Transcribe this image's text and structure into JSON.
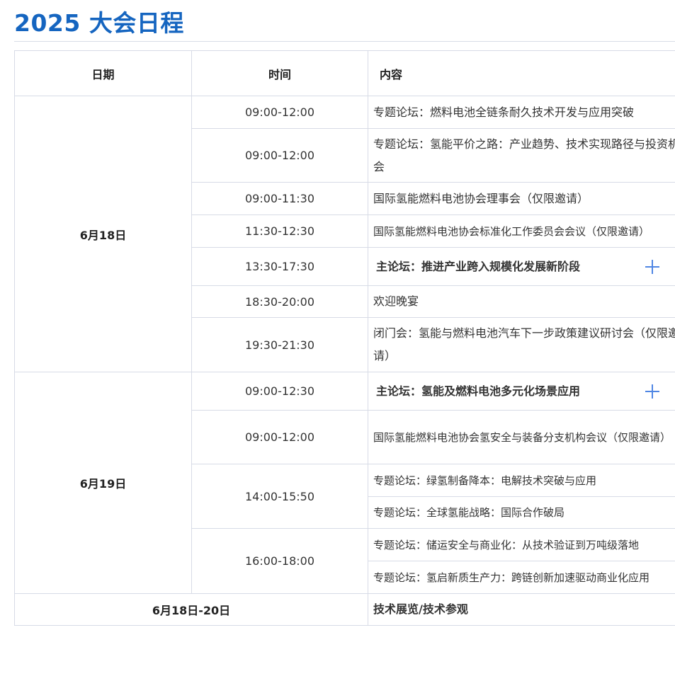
{
  "page": {
    "title": "2025 大会日程"
  },
  "table": {
    "headers": {
      "date": "日期",
      "time": "时间",
      "content": "内容"
    },
    "day1": {
      "date": "6月18日",
      "rows": [
        {
          "time": "09:00-12:00",
          "content": "专题论坛：燃料电池全链条耐久技术开发与应用突破"
        },
        {
          "time": "09:00-12:00",
          "content": "专题论坛：氢能平价之路：产业趋势、技术实现路径与投资机会"
        },
        {
          "time": "09:00-11:30",
          "content": "国际氢能燃料电池协会理事会（仅限邀请）"
        },
        {
          "time": "11:30-12:30",
          "content": "国际氢能燃料电池协会标准化工作委员会会议（仅限邀请）"
        },
        {
          "time": "13:30-17:30",
          "content": "主论坛：推进产业跨入规模化发展新阶段",
          "expand_icon": "plus-icon"
        },
        {
          "time": "18:30-20:00",
          "content": "欢迎晚宴"
        },
        {
          "time": "19:30-21:30",
          "content": "闭门会：氢能与燃料电池汽车下一步政策建议研讨会（仅限邀请）"
        }
      ]
    },
    "day2": {
      "date": "6月19日",
      "rows": [
        {
          "time": "09:00-12:30",
          "content": "主论坛：氢能及燃料电池多元化场景应用",
          "expand_icon": "plus-icon"
        },
        {
          "time": "09:00-12:00",
          "content": "国际氢能燃料电池协会氢安全与装备分支机构会议（仅限邀请）"
        },
        {
          "time": "14:00-15:50",
          "contents": [
            "专题论坛：绿氢制备降本：电解技术突破与应用",
            "专题论坛：全球氢能战略：国际合作破局"
          ]
        },
        {
          "time": "16:00-18:00",
          "contents": [
            "专题论坛：储运安全与商业化：从技术验证到万吨级落地",
            "专题论坛：氢启新质生产力：跨链创新加速驱动商业化应用"
          ]
        }
      ]
    },
    "exhibition": {
      "dates": "6月18日-20日",
      "content": "技术展览/技术参观"
    }
  },
  "colors": {
    "title": "#1565c0",
    "border": "#d7dbe6",
    "plus_icon": "#4f86e4"
  }
}
